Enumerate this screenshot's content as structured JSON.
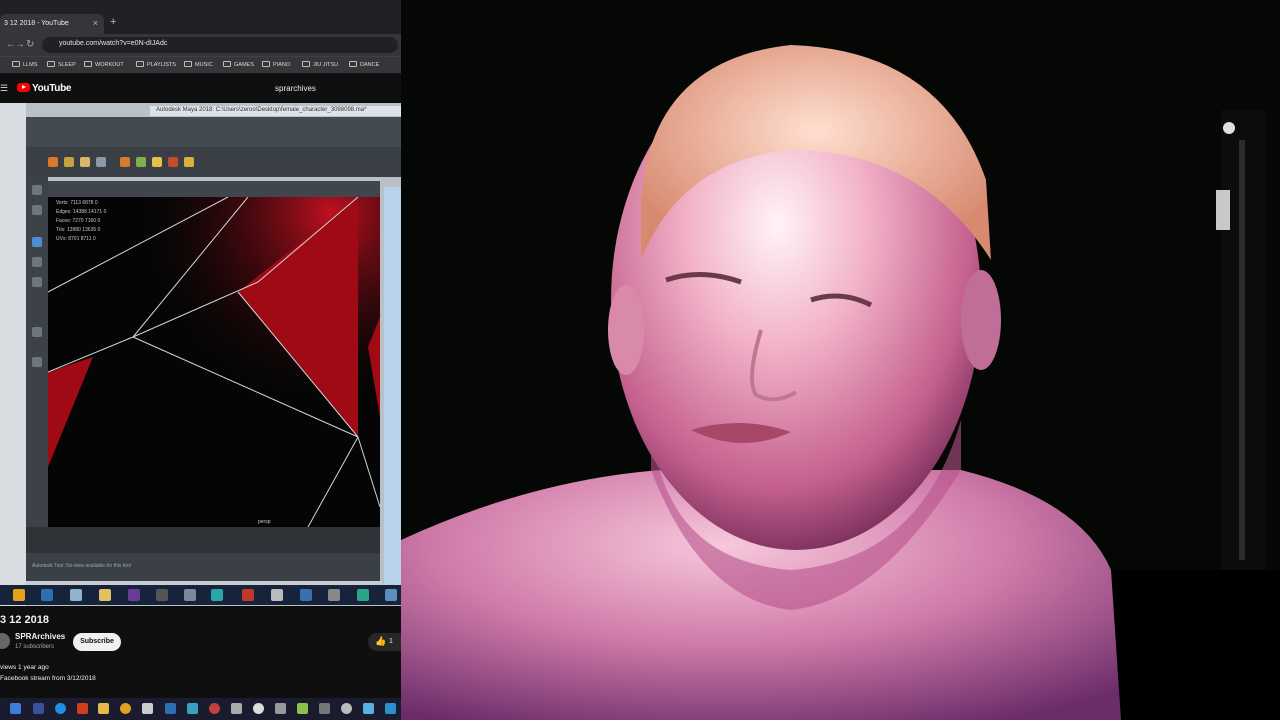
{
  "browser": {
    "tab_title": "3 12 2018 - YouTube",
    "tab_close": "×",
    "new_tab": "+",
    "url": "youtube.com/watch?v=e0N-dIJAdc",
    "back": "←",
    "forward": "→",
    "reload": "↻",
    "bookmarks": [
      "LLMS",
      "SLEEP",
      "WORKOUT",
      "PLAYLISTS",
      "MUSIC",
      "GAMES",
      "PIANO",
      "JIU JITSU",
      "DANCE"
    ]
  },
  "youtube": {
    "menu_icon": "☰",
    "logo_text": "YouTube",
    "search_query": "sprarchives",
    "player": {
      "maya_title": "Autodesk Maya 2018: C:\\Users\\zeroo\\Desktop\\female_character_3098098.ma*",
      "stats": [
        {
          "label": "Verts:",
          "a": "7113",
          "b": "6878",
          "c": "0"
        },
        {
          "label": "Edges:",
          "a": "14388",
          "b": "14171",
          "c": "0"
        },
        {
          "label": "Faces:",
          "a": "7270",
          "b": "7160",
          "c": "0"
        },
        {
          "label": "Tris:",
          "a": "13980",
          "b": "13635",
          "c": "0"
        },
        {
          "label": "UVs:",
          "a": "8701",
          "b": "8711",
          "c": "0"
        }
      ],
      "cmd_hint": "Autodesk Tool: No view available for this tool",
      "frame_label": "persp"
    },
    "video_title": "3 12 2018",
    "channel_name": "SPRArchives",
    "subscribers": "17 subscribers",
    "subscribe_label": "Subscribe",
    "like_icon": "👍",
    "like_count": "1",
    "views_line": "views  1 year ago",
    "description_line": "Facebook stream from 3/12/2018"
  },
  "colors": {
    "youtube_red": "#ff0000",
    "maya_viewport_red": "#a00a14",
    "webcam_background": "#050705"
  }
}
